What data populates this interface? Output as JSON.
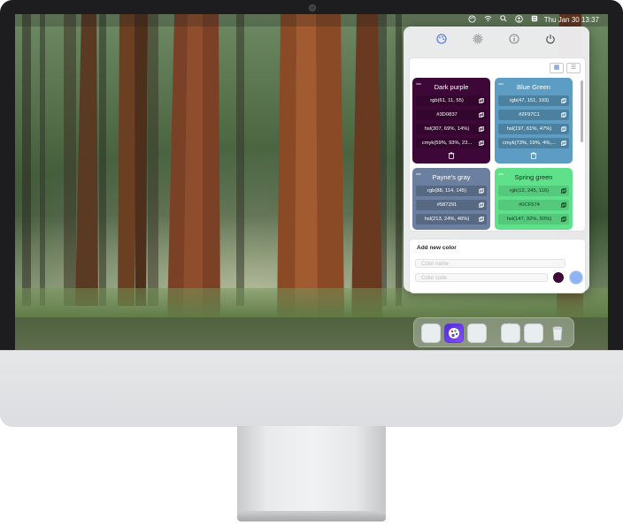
{
  "menubar": {
    "icons": [
      "palette-menu-icon",
      "wifi-icon",
      "search-icon",
      "user-icon",
      "control-center-icon"
    ],
    "datetime": "Thu Jan 30  13:37"
  },
  "panel": {
    "top_icons": [
      "palette-tab-icon",
      "gear-icon",
      "info-icon",
      "power-icon"
    ],
    "view_toggle": [
      "grid-view-icon",
      "list-view-icon"
    ],
    "colors": [
      {
        "name": "Dark purple",
        "bg": "#3d0837",
        "values": [
          "rgb(61, 11, 55)",
          "#3D0837",
          "hsl(307, 69%, 14%)",
          "cmyk(59%, 93%, 23..."
        ]
      },
      {
        "name": "Blue Green",
        "bg": "#2f97c1",
        "values": [
          "rgb(47, 151, 193)",
          "#2F97C1",
          "hsl(197, 61%, 47%)",
          "cmyk(73%, 19%, 4%,..."
        ]
      },
      {
        "name": "Payne's gray",
        "bg": "#587291",
        "values": [
          "rgb(88, 114, 145)",
          "#587291",
          "hsl(213, 24%, 46%)"
        ]
      },
      {
        "name": "Spring green",
        "bg": "#0cf574",
        "values": [
          "rgb(12, 245, 116)",
          "#0CF574",
          "hsl(147, 92%, 50%)"
        ]
      }
    ],
    "add": {
      "title": "Add new color",
      "name_placeholder": "Color name",
      "code_placeholder": "Color code",
      "swatch_color": "#3d0837",
      "picker_color": "#8fb4f2"
    }
  },
  "dock": {
    "apps": [
      "app-icon",
      "color-palette-app-icon",
      "app-icon",
      "app-icon",
      "app-icon",
      "trash-icon"
    ]
  }
}
